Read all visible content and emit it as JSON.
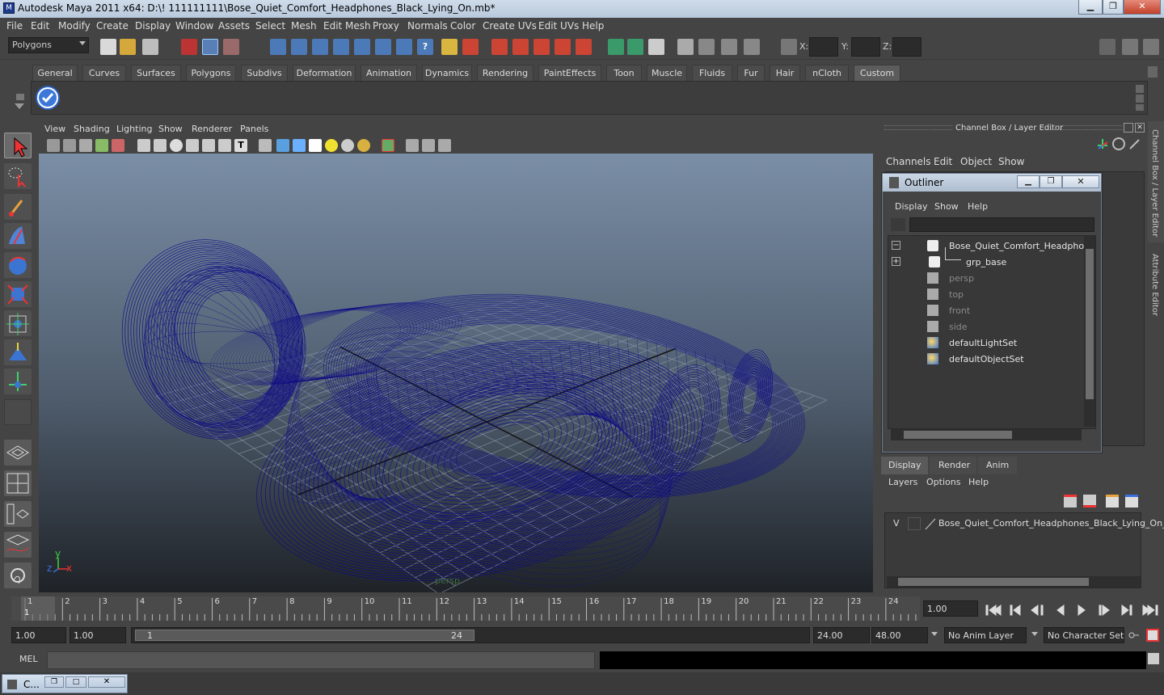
{
  "window": {
    "title": "Autodesk Maya 2011 x64: D:\\! 111111111\\Bose_Quiet_Comfort_Headphones_Black_Lying_On.mb*",
    "minimize_icon": "minimize-icon",
    "restore_icon": "restore-icon",
    "close_icon": "close-icon"
  },
  "menubar": [
    "File",
    "Edit",
    "Modify",
    "Create",
    "Display",
    "Window",
    "Assets",
    "Select",
    "Mesh",
    "Edit Mesh",
    "Proxy",
    "Normals",
    "Color",
    "Create UVs",
    "Edit UVs",
    "Help"
  ],
  "statusline": {
    "menuset": "Polygons",
    "x_label": "X:",
    "y_label": "Y:",
    "z_label": "Z:"
  },
  "shelf": {
    "tabs": [
      "General",
      "Curves",
      "Surfaces",
      "Polygons",
      "Subdivs",
      "Deformation",
      "Animation",
      "Dynamics",
      "Rendering",
      "PaintEffects",
      "Toon",
      "Muscle",
      "Fluids",
      "Fur",
      "Hair",
      "nCloth",
      "Custom"
    ],
    "active_tab": "Custom"
  },
  "viewport": {
    "menu": [
      "View",
      "Shading",
      "Lighting",
      "Show",
      "Renderer",
      "Panels"
    ],
    "camera_label": "persp",
    "axis_x": "x",
    "axis_y": "y",
    "axis_z": "z",
    "wire_color": "#0d0a86"
  },
  "channel_box": {
    "title": "Channel Box / Layer Editor",
    "menu": [
      "Channels",
      "Edit",
      "Object",
      "Show"
    ]
  },
  "outliner": {
    "title": "Outliner",
    "menu": [
      "Display",
      "Show",
      "Help"
    ],
    "items": [
      {
        "label": "Bose_Quiet_Comfort_Headphones",
        "icon": "transform-icon",
        "expand": "−",
        "dim": false
      },
      {
        "label": "grp_base",
        "icon": "transform-icon",
        "expand": "+",
        "dim": false
      },
      {
        "label": "persp",
        "icon": "camera-icon",
        "expand": "",
        "dim": true
      },
      {
        "label": "top",
        "icon": "camera-icon",
        "expand": "",
        "dim": true
      },
      {
        "label": "front",
        "icon": "camera-icon",
        "expand": "",
        "dim": true
      },
      {
        "label": "side",
        "icon": "camera-icon",
        "expand": "",
        "dim": true
      },
      {
        "label": "defaultLightSet",
        "icon": "set-icon",
        "expand": "",
        "dim": false
      },
      {
        "label": "defaultObjectSet",
        "icon": "set-icon",
        "expand": "",
        "dim": false
      }
    ]
  },
  "layer_editor": {
    "tabs": [
      "Display",
      "Render",
      "Anim"
    ],
    "active_tab": "Display",
    "menu": [
      "Layers",
      "Options",
      "Help"
    ],
    "layer_visibility": "V",
    "layer_name": "Bose_Quiet_Comfort_Headphones_Black_Lying_On_"
  },
  "timeline": {
    "ticks": [
      "1",
      "2",
      "3",
      "4",
      "5",
      "6",
      "7",
      "8",
      "9",
      "10",
      "11",
      "12",
      "13",
      "14",
      "15",
      "16",
      "17",
      "18",
      "19",
      "20",
      "21",
      "22",
      "23",
      "24"
    ],
    "current_frame_marker": "1",
    "current_time": "1.00"
  },
  "range": {
    "start_time": "1.00",
    "playback_start": "1.00",
    "range_start": "1",
    "range_end": "24",
    "playback_end": "24.00",
    "end_time": "48.00",
    "anim_layer": "No Anim Layer",
    "character_set": "No Character Set"
  },
  "command_line": {
    "label": "MEL"
  },
  "taskbar": {
    "item": "C..."
  }
}
